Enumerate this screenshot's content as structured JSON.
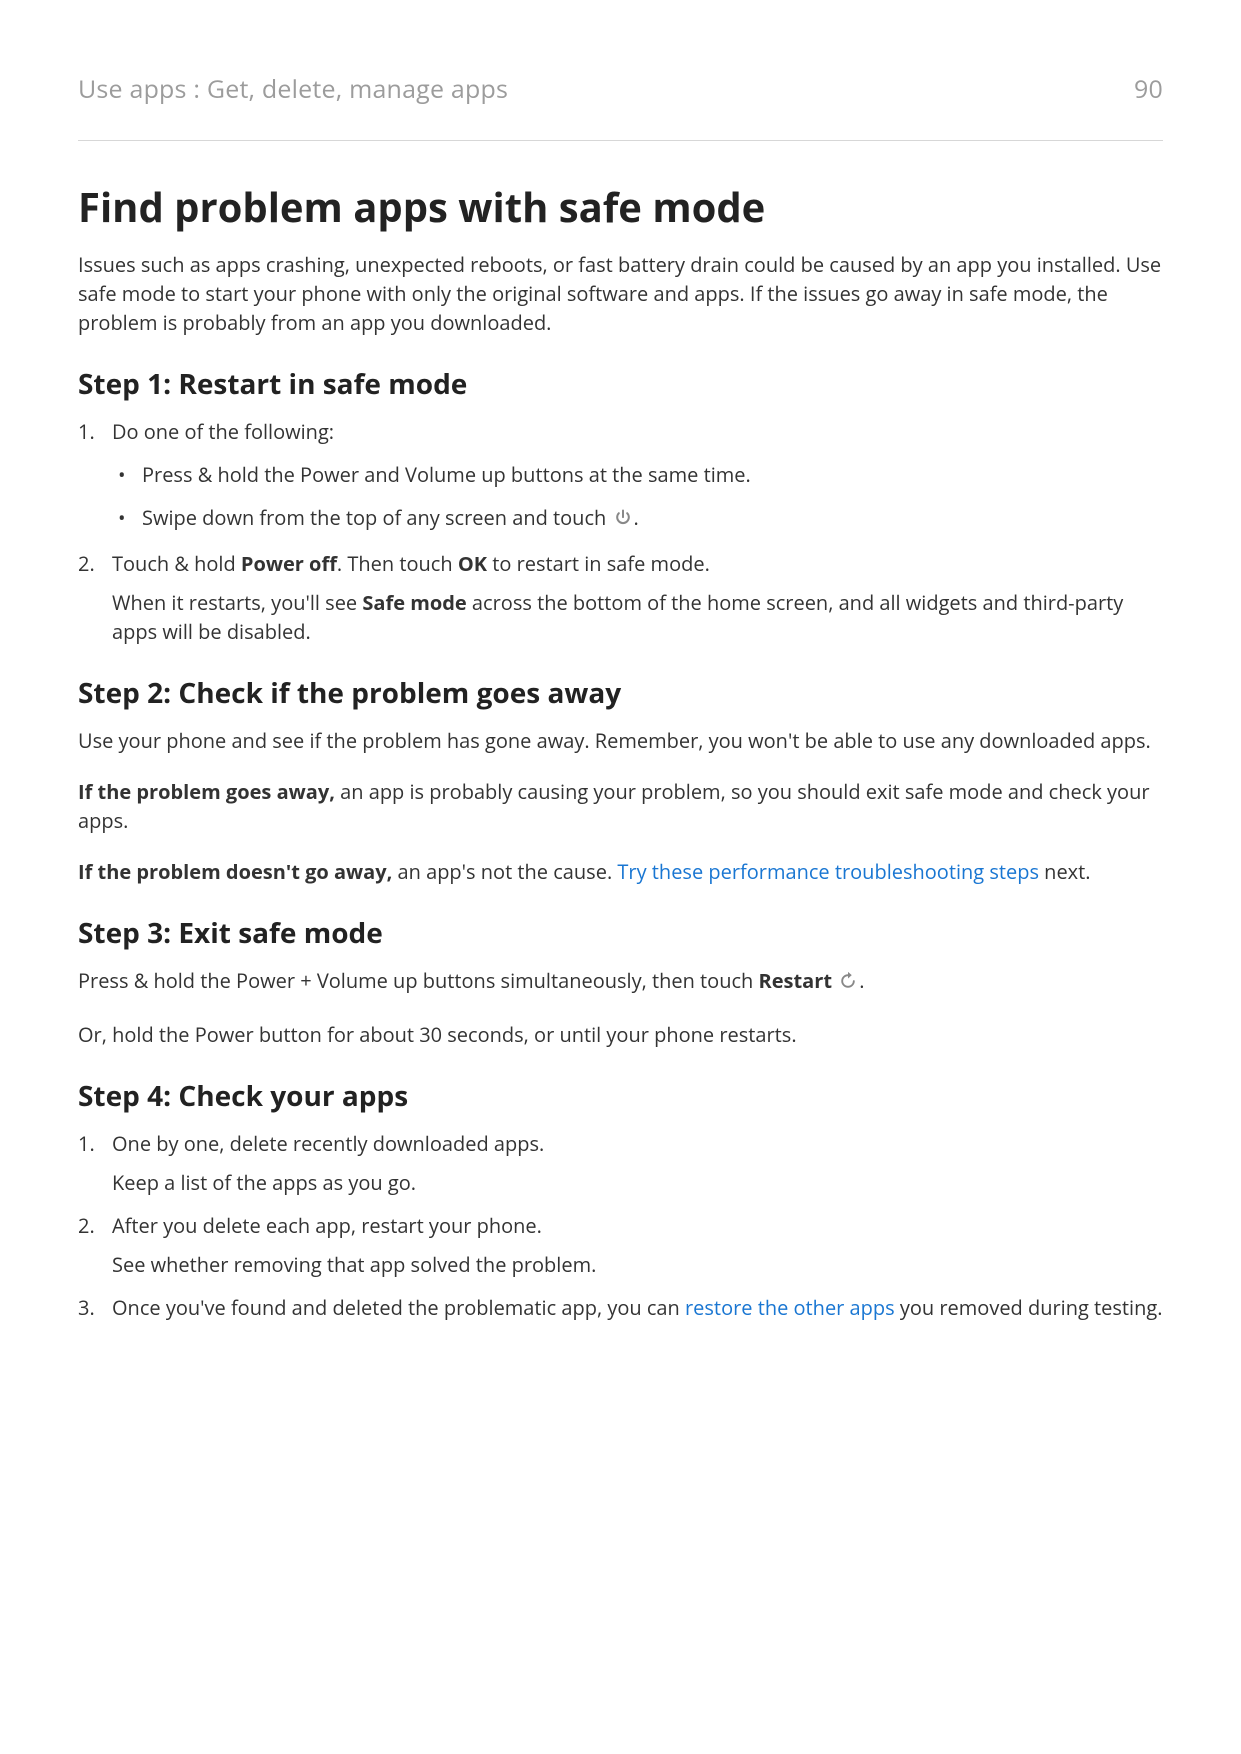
{
  "header": {
    "breadcrumb": "Use apps : Get, delete, manage apps",
    "page_number": "90"
  },
  "title": "Find problem apps with safe mode",
  "intro": "Issues such as apps crashing, unexpected reboots, or fast battery drain could be caused by an app you installed. Use safe mode to start your phone with only the original software and apps. If the issues go away in safe mode, the problem is probably from an app you downloaded.",
  "step1": {
    "heading": "Step 1: Restart in safe mode",
    "li1": "Do one of the following:",
    "bullet1": "Press & hold the Power and Volume up buttons at the same time.",
    "bullet2a": "Swipe down from the top of any screen and touch ",
    "bullet2b": ".",
    "li2a": "Touch & hold ",
    "li2_bold1": "Power off",
    "li2b": ". Then touch ",
    "li2_bold2": "OK",
    "li2c": " to restart in safe mode.",
    "li2_sub_a": "When it restarts, you'll see ",
    "li2_sub_bold": "Safe mode",
    "li2_sub_b": " across the bottom of the home screen, and all widgets and third-party apps will be disabled."
  },
  "step2": {
    "heading": "Step 2: Check if the problem goes away",
    "p1": "Use your phone and see if the problem has gone away. Remember, you won't be able to use any downloaded apps.",
    "p2_bold": "If the problem goes away,",
    "p2_rest": " an app is probably causing your problem, so you should exit safe mode and check your apps.",
    "p3_bold": "If the problem doesn't go away,",
    "p3_mid": " an app's not the cause. ",
    "p3_link": "Try these performance troubleshooting steps",
    "p3_end": " next."
  },
  "step3": {
    "heading": "Step 3: Exit safe mode",
    "p1_a": "Press & hold the Power + Volume up buttons simultaneously, then touch ",
    "p1_bold": "Restart",
    "p1_b": " ",
    "p1_c": ".",
    "p2": "Or, hold the Power button for about 30 seconds, or until your phone restarts."
  },
  "step4": {
    "heading": "Step 4: Check your apps",
    "li1": "One by one, delete recently downloaded apps.",
    "li1_sub": "Keep a list of the apps as you go.",
    "li2": "After you delete each app, restart your phone.",
    "li2_sub": "See whether removing that app solved the problem.",
    "li3_a": "Once you've found and deleted the problematic app, you can ",
    "li3_link": "restore the other apps",
    "li3_b": " you removed during testing."
  }
}
